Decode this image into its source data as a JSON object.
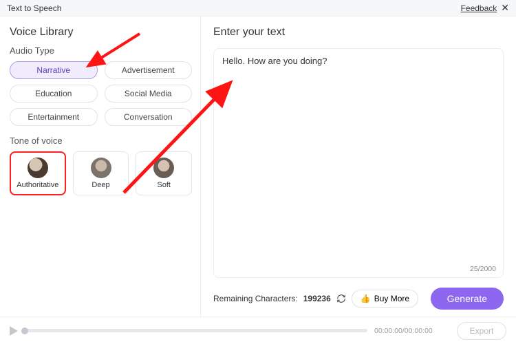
{
  "topbar": {
    "title": "Text to Speech",
    "feedback": "Feedback"
  },
  "sidebar": {
    "title": "Voice Library",
    "audio_type_label": "Audio Type",
    "audio_types": [
      "Narrative",
      "Advertisement",
      "Education",
      "Social Media",
      "Entertainment",
      "Conversation"
    ],
    "selected_audio_type": 0,
    "tone_label": "Tone of voice",
    "tones": [
      "Authoritative",
      "Deep",
      "Soft"
    ],
    "highlighted_tone": 0
  },
  "content": {
    "heading": "Enter your text",
    "text_value": "Hello. How are you doing?",
    "char_count": "25/2000",
    "remaining_label": "Remaining Characters:",
    "remaining_value": "199236",
    "buy_more_label": "Buy More",
    "generate_label": "Generate"
  },
  "player": {
    "time": "00:00:00/00:00:00",
    "export_label": "Export"
  }
}
